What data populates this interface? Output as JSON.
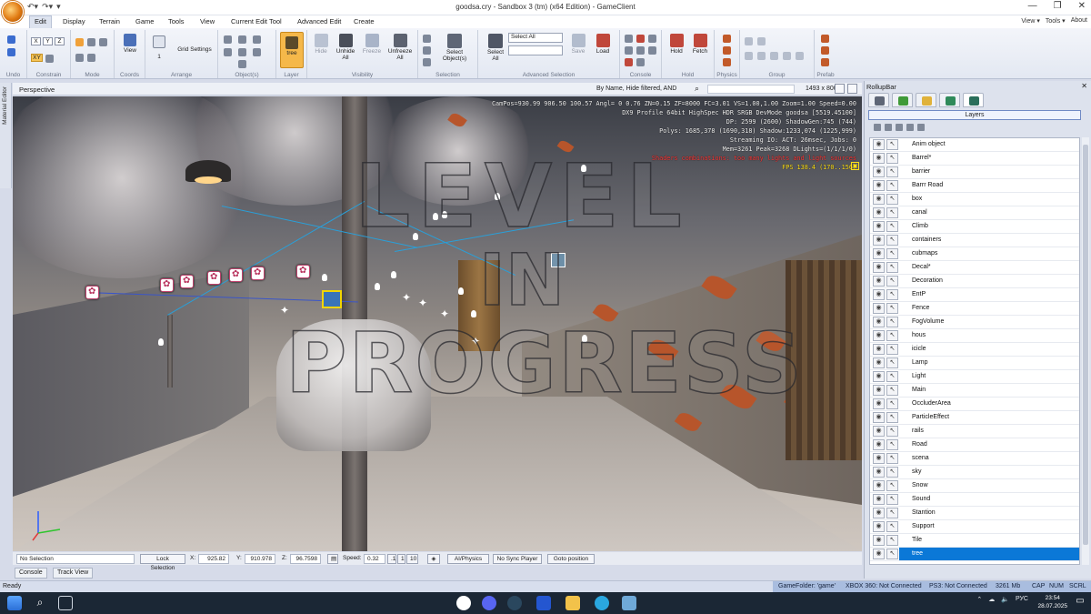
{
  "window": {
    "title": "goodsa.cry - Sandbox 3 (tm) (x64 Edition) - GameClient",
    "min_glyph": "—",
    "max_glyph": "❐",
    "close_glyph": "✕"
  },
  "menu": {
    "tabs": [
      "Edit",
      "Display",
      "Terrain",
      "Game",
      "Tools",
      "View",
      "Current Edit Tool",
      "Advanced Edit",
      "Create"
    ],
    "active": "Edit",
    "right": [
      "View ▾",
      "Tools ▾",
      "About"
    ]
  },
  "ribbon": {
    "groups": [
      {
        "id": "undo",
        "label": "Undo"
      },
      {
        "id": "constrain",
        "label": "Constrain",
        "buttons": [
          "X",
          "Y",
          "Z",
          "XY"
        ]
      },
      {
        "id": "mode",
        "label": "Mode"
      },
      {
        "id": "coords",
        "label": "Coords",
        "buttons": [
          "View"
        ]
      },
      {
        "id": "arrange",
        "label": "Arrange",
        "buttons": [
          "Grid Settings",
          "1"
        ]
      },
      {
        "id": "objects",
        "label": "Object(s)"
      },
      {
        "id": "layer",
        "label": "Layer",
        "buttons": [
          "tree"
        ]
      },
      {
        "id": "visibility",
        "label": "Visibility",
        "buttons": [
          "Hide",
          "Unhide All",
          "Freeze",
          "Unfreeze All"
        ]
      },
      {
        "id": "selection",
        "label": "Selection",
        "buttons": [
          "Select Object(s)"
        ]
      },
      {
        "id": "advanced",
        "label": "Advanced Selection",
        "buttons": [
          "Select All",
          "Select All",
          "Save",
          "Load"
        ]
      },
      {
        "id": "console",
        "label": "Console"
      },
      {
        "id": "hold",
        "label": "Hold",
        "buttons": [
          "Hold",
          "Fetch"
        ]
      },
      {
        "id": "physics",
        "label": "Physics"
      },
      {
        "id": "group",
        "label": "Group"
      },
      {
        "id": "prefab",
        "label": "Prefab"
      }
    ]
  },
  "viewport": {
    "label": "Perspective",
    "filter": "By Name, Hide filtered, AND",
    "size": "1493 x 800",
    "material_editor": "Material Editor",
    "hud": {
      "lines": [
        "CamPos=930.99 906.50 100.57 Angl= 0 0.76 ZN=0.15 ZF=8000 FC=3.01 VS=1.00,1.00 Zoom=1.00 Speed=0.00",
        "DX9 Profile 64bit HighSpec HDR SRGB DevMode goodsa [5519.45100]",
        "DP: 2599 (2600) ShadowGen:745 (744)",
        "Polys: 1685,378 (1690,318) Shadow:1233,074 (1225,999)",
        "Streaming IO: ACT: 26msec, Jobs: 0",
        "Mem=3261 Peak=3268 DLights=(1/1/1/0)"
      ],
      "warning": "Shaders combinations: too many lights and light sources",
      "fps": "FPS 138.4 (170..156)"
    },
    "watermark": [
      "LEVEL",
      "IN",
      "PROGRESS"
    ]
  },
  "status_row": {
    "selection": "No Selection",
    "lock": "Lock Selection",
    "x_label": "X:",
    "x": "925.82",
    "y_label": "Y:",
    "y": "910.978",
    "z_label": "Z:",
    "z": "96.7598",
    "speed_label": "Speed:",
    "speed": "0.32",
    "speed_presets": [
      ".1",
      "1",
      "10"
    ],
    "ai_physics": "AI/Physics",
    "sync": "No Sync Player",
    "goto": "Goto position"
  },
  "bottom_tabs": [
    "Console",
    "Track View"
  ],
  "statusbar": {
    "ready": "Ready",
    "game_folder": "GameFolder: 'game'",
    "xbox": "XBOX 360: Not Connected",
    "ps3": "PS3: Not Connected",
    "memory": "3261 Mb",
    "caps": "CAP",
    "num": "NUM",
    "scrl": "SCRL"
  },
  "rollup": {
    "title": "RollupBar",
    "close": "✕",
    "section": "Layers",
    "layers": [
      "Anim object",
      "Barrel*",
      "barrier",
      "Barrr Road",
      "box",
      "canal",
      "Climb",
      "containers",
      "cubmaps",
      "Decal*",
      "Decoration",
      "EntP",
      "Fence",
      "FogVolume",
      "hous",
      "icicle",
      "Lamp",
      "Light",
      "Main",
      "OccluderArea",
      "ParticleEffect",
      "rails",
      "Road",
      "scena",
      "sky",
      "Snow",
      "Sound",
      "Stantion",
      "Support",
      "Tile",
      "tree"
    ],
    "selected": "tree"
  },
  "taskbar": {
    "language": "РУС",
    "time": "23:54",
    "date": "28.07.2025"
  },
  "colors": {
    "accent": "#0b78d7",
    "ribbon_highlight": "#f5b84a",
    "status_bar_right": "#a9bddf"
  }
}
